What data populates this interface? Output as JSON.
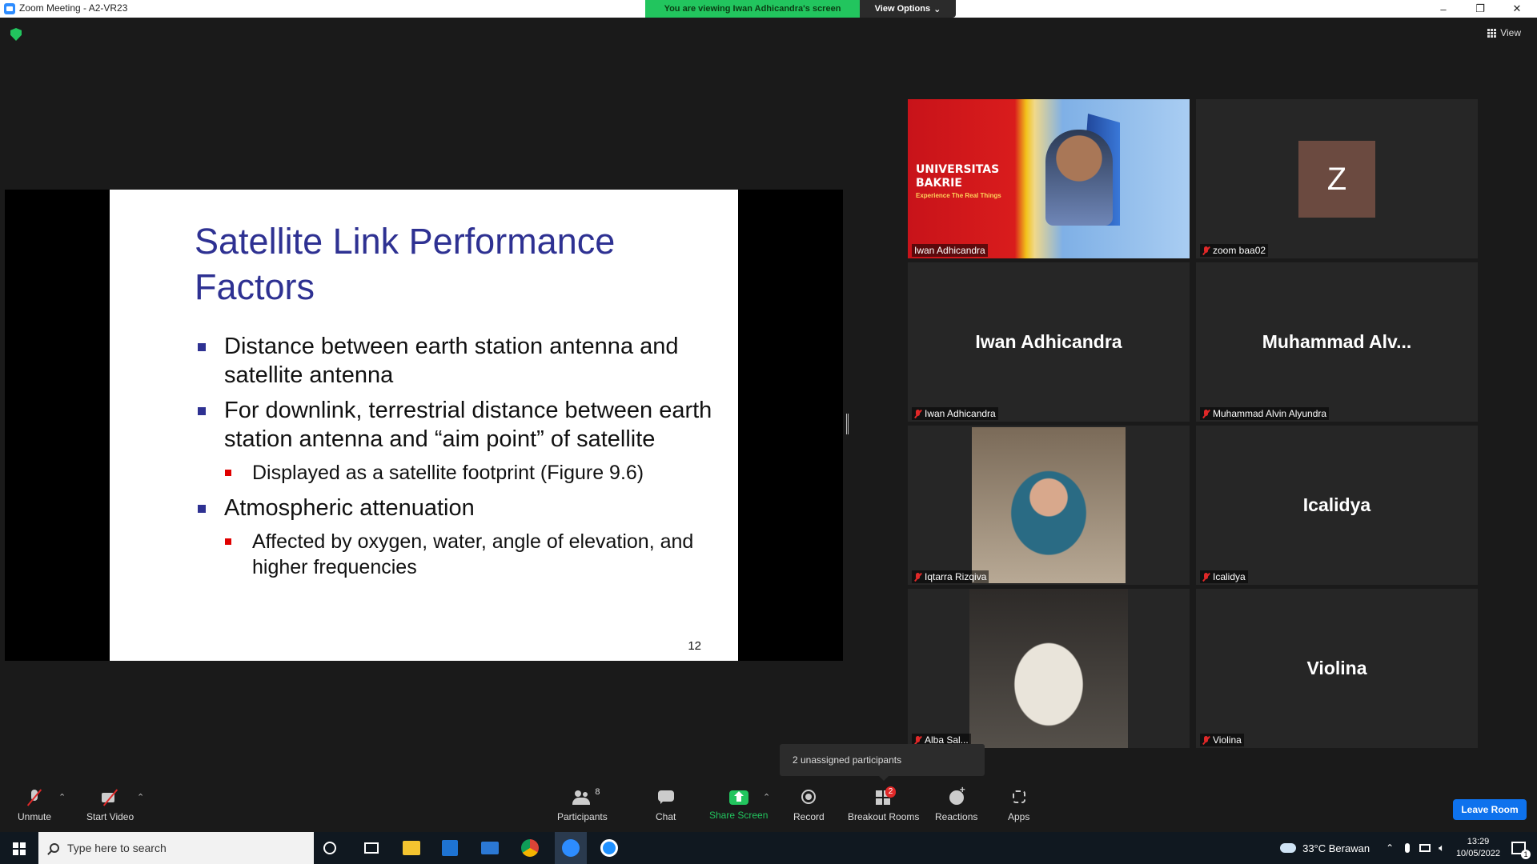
{
  "window": {
    "title": "Zoom Meeting - A2-VR23",
    "minimize": "–",
    "restore": "❐",
    "close": "✕"
  },
  "banner": {
    "viewing_text": "You are viewing Iwan Adhicandra's screen",
    "view_options": "View Options",
    "view_options_caret": "⌄"
  },
  "top_right": {
    "view_label": "View"
  },
  "slide": {
    "title": "Satellite Link Performance Factors",
    "bullets": [
      "Distance between earth station antenna and satellite antenna",
      "For downlink, terrestrial distance between earth station antenna and “aim point” of satellite",
      "Displayed as a satellite footprint (Figure 9.6)",
      "Atmospheric attenuation",
      "Affected by oxygen, water, angle of elevation, and higher frequencies"
    ],
    "page_number": "12"
  },
  "gallery": {
    "tiles": [
      {
        "name": "Iwan Adhicandra",
        "brand_line1": "UNIVERSITAS",
        "brand_line2": "BAKRIE",
        "brand_tagline": "Experience The Real Things",
        "active_speaker": true
      },
      {
        "name": "zoom baa02",
        "avatar_letter": "Z"
      },
      {
        "display_name": "Iwan Adhicandra",
        "name": "Iwan Adhicandra"
      },
      {
        "display_name": "Muhammad  Alv...",
        "name": "Muhammad Alvin Alyundra"
      },
      {
        "name": "Iqtarra Rizqiva"
      },
      {
        "display_name": "Icalidya",
        "name": "Icalidya"
      },
      {
        "name": "Alba Sal..."
      },
      {
        "display_name": "Violina",
        "name": "Violina"
      }
    ]
  },
  "toolbar": {
    "unmute": "Unmute",
    "start_video": "Start Video",
    "participants": "Participants",
    "participants_count": "8",
    "chat": "Chat",
    "share_screen": "Share Screen",
    "record": "Record",
    "breakout_rooms": "Breakout Rooms",
    "breakout_badge": "2",
    "reactions": "Reactions",
    "apps": "Apps",
    "leave_room": "Leave Room",
    "caret": "⌃",
    "share_color": "#22c55e",
    "leave_color": "#0e72ed"
  },
  "tooltip": {
    "text": "2 unassigned participants"
  },
  "taskbar": {
    "search_placeholder": "Type here to search",
    "weather": "33°C  Berawan",
    "time": "13:29",
    "date": "10/05/2022",
    "notifications": "1"
  }
}
